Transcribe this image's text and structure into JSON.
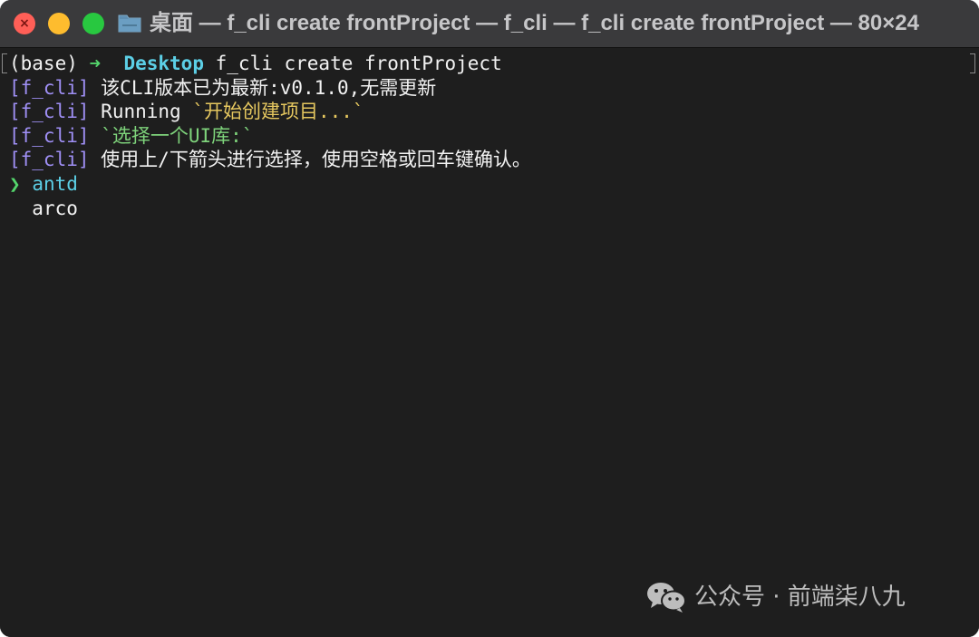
{
  "window": {
    "title": "桌面 — f_cli create frontProject — f_cli — f_cli create frontProject — 80×24",
    "icons": {
      "close": "close-icon",
      "minimize": "minimize-icon",
      "zoom": "zoom-icon",
      "folder": "folder-icon"
    }
  },
  "colors": {
    "close": "#ff5f57",
    "minimize": "#febc2e",
    "zoom": "#28c840",
    "terminal_bg": "#1e1e1e",
    "tag": "#9f8ff5",
    "prompt_arrow": "#54d56c",
    "directory": "#5ccfe6",
    "yellow_text": "#e5c75f",
    "green_text": "#7ed37b"
  },
  "terminal": {
    "prompt": {
      "env": "(base)",
      "arrow": "➜",
      "directory": "Desktop",
      "command": "f_cli create frontProject"
    },
    "lines": [
      {
        "tag": "[f_cli]",
        "text": "该CLI版本已为最新:v0.1.0,无需更新"
      },
      {
        "tag": "[f_cli]",
        "prefix": "Running ",
        "highlight": "`开始创建项目...`"
      },
      {
        "tag": "[f_cli]",
        "highlight": "`选择一个UI库:`"
      },
      {
        "tag": "[f_cli]",
        "text": "使用上/下箭头进行选择，使用空格或回车键确认。"
      }
    ],
    "options": [
      {
        "pointer": "❯",
        "label": "antd",
        "selected": true
      },
      {
        "pointer": "",
        "label": "arco",
        "selected": false
      }
    ]
  },
  "watermark": {
    "icon": "wechat-icon",
    "text": "公众号 · 前端柒八九"
  }
}
